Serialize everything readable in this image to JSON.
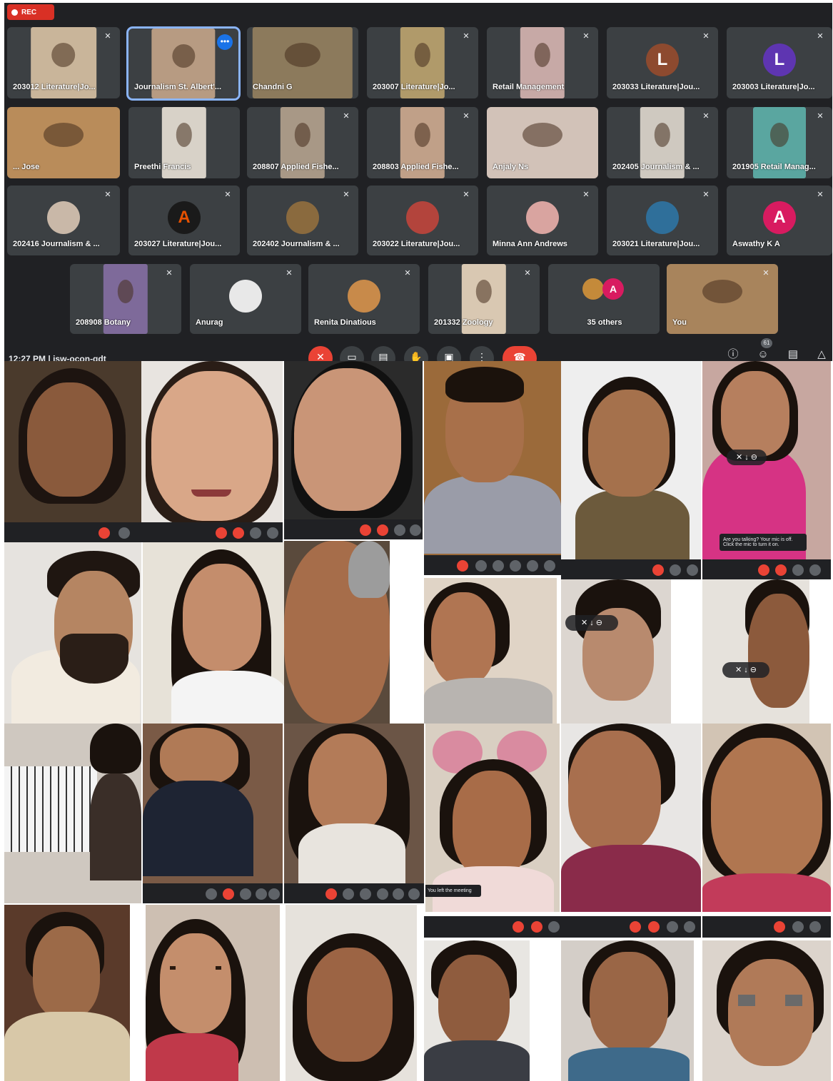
{
  "meeting": {
    "rec_label": "REC",
    "clock": "12:27 PM",
    "code": "isw-ocon-qdt",
    "participant_count_badge": "61",
    "tiles_row1": [
      {
        "name": "203012 Literature|Jo..."
      },
      {
        "name": "Journalism St. Albert'..."
      },
      {
        "name": "Chandni G"
      },
      {
        "name": "203007 Literature|Jo..."
      },
      {
        "name": "Retail Management"
      },
      {
        "name": "203033 Literature|Jou...",
        "initial": "L"
      },
      {
        "name": "203003 Literature|Jo...",
        "initial": "L"
      }
    ],
    "tiles_row2": [
      {
        "name": "... Jose"
      },
      {
        "name": "Preethi Francis"
      },
      {
        "name": "208807 Applied Fishe..."
      },
      {
        "name": "208803 Applied Fishe..."
      },
      {
        "name": "Anjaly Ns"
      },
      {
        "name": "202405 Journalism & ..."
      },
      {
        "name": "201905 Retail Manag..."
      }
    ],
    "tiles_row3": [
      {
        "name": "202416 Journalism & ..."
      },
      {
        "name": "203027 Literature|Jou...",
        "initial": "A"
      },
      {
        "name": "202402 Journalism & ..."
      },
      {
        "name": "203022 Literature|Jou..."
      },
      {
        "name": "Minna Ann Andrews"
      },
      {
        "name": "203021 Literature|Jou..."
      },
      {
        "name": "Aswathy K A",
        "initial": "A"
      }
    ],
    "tiles_row4": [
      {
        "name": "208908 Botany"
      },
      {
        "name": "Anurag"
      },
      {
        "name": "Renita Dinatious"
      },
      {
        "name": "201332 Zoology"
      },
      {
        "name": "35 others",
        "initial": "A"
      },
      {
        "name": "You"
      }
    ],
    "colors": {
      "bg": "#202124",
      "tile": "#3c4043",
      "accent": "#1a73e8",
      "danger": "#ea4335"
    },
    "icons": [
      "mic-off-icon",
      "camera-icon",
      "captions-icon",
      "raise-hand-icon",
      "present-icon",
      "more-icon",
      "end-call-icon",
      "info-icon",
      "people-icon",
      "chat-icon",
      "activities-icon"
    ]
  },
  "collage": {
    "toasts": [
      "Are you talking? Your mic is off. Click the mic to turn it on.",
      "You left the meeting"
    ]
  }
}
